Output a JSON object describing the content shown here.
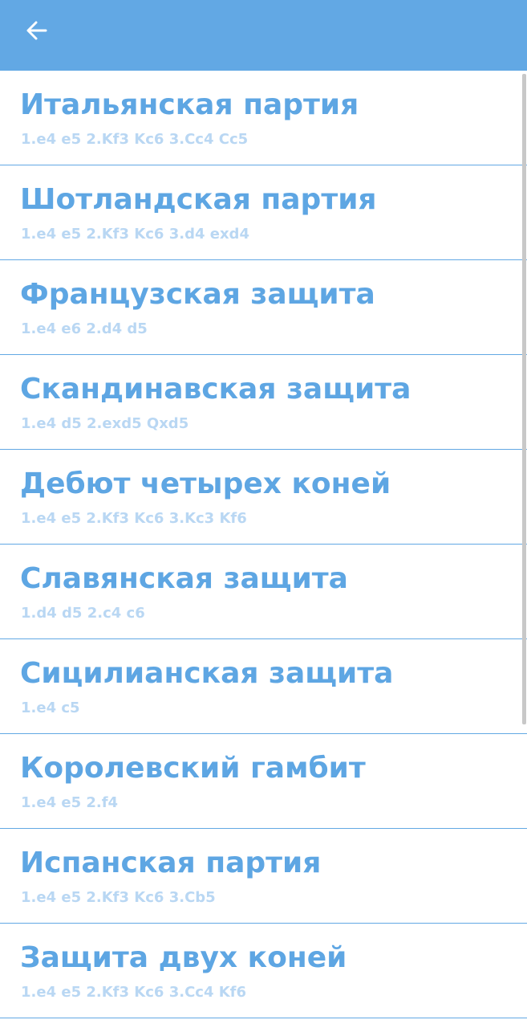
{
  "header": {
    "back_icon": "arrow-left-icon",
    "bar_color": "#62a8e4"
  },
  "openings": [
    {
      "title": "Итальянская партия",
      "moves": "1.e4 e5 2.Kf3 Kc6 3.Cc4 Cc5"
    },
    {
      "title": "Шотландская партия",
      "moves": "1.e4 e5 2.Kf3 Kc6 3.d4 exd4"
    },
    {
      "title": "Французская защита",
      "moves": "1.e4 e6 2.d4 d5"
    },
    {
      "title": "Скандинавская защита",
      "moves": "1.e4 d5 2.exd5 Qxd5"
    },
    {
      "title": "Дебют четырех коней",
      "moves": "1.e4 e5 2.Kf3 Kc6 3.Kc3 Kf6"
    },
    {
      "title": "Славянская защита",
      "moves": "1.d4 d5 2.c4 c6"
    },
    {
      "title": "Сицилианская защита",
      "moves": "1.e4 c5"
    },
    {
      "title": "Королевский гамбит",
      "moves": "1.e4 e5 2.f4"
    },
    {
      "title": "Испанская партия",
      "moves": "1.e4 e5 2.Kf3 Kc6 3.Cb5"
    },
    {
      "title": "Защита двух коней",
      "moves": "1.e4 e5 2.Kf3 Kc6 3.Cc4 Kf6"
    }
  ]
}
